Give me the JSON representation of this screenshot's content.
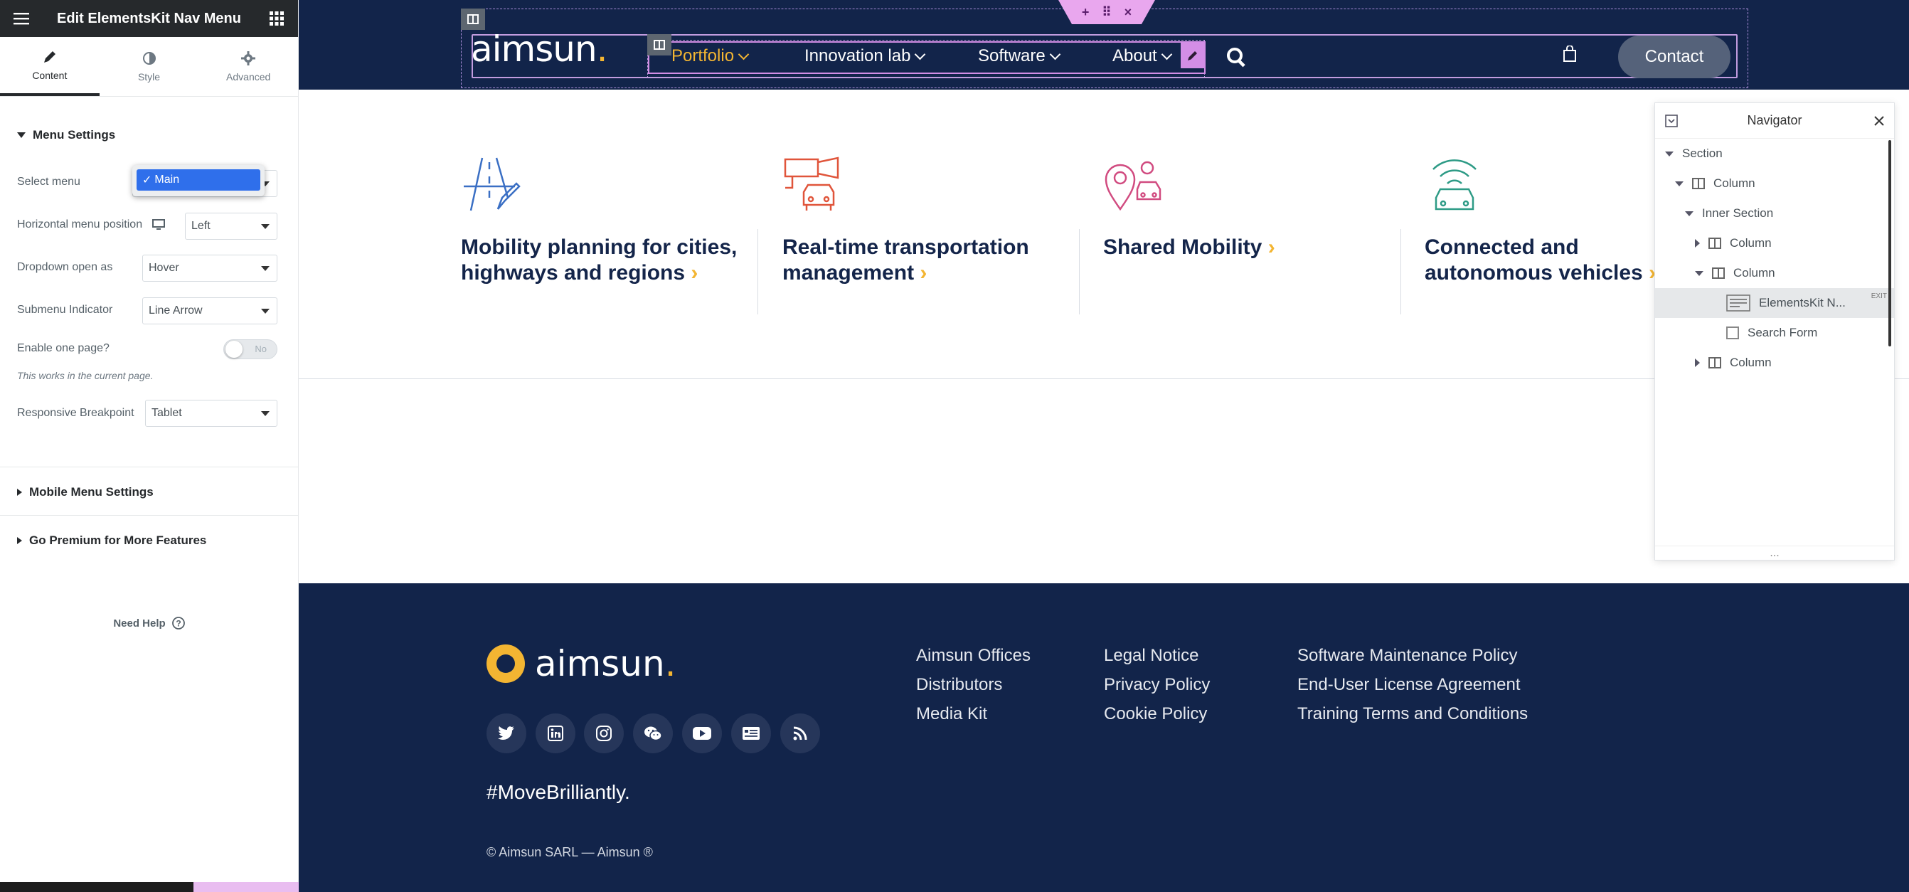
{
  "panel": {
    "title": "Edit ElementsKit Nav Menu",
    "tabs": [
      {
        "label": "Content"
      },
      {
        "label": "Style"
      },
      {
        "label": "Advanced"
      }
    ],
    "menu_settings": {
      "heading": "Menu Settings",
      "select_menu_label": "Select menu",
      "select_menu_value": "Main",
      "horizontal_position_label": "Horizontal menu position",
      "horizontal_position_value": "Left",
      "dropdown_open_label": "Dropdown open as",
      "dropdown_open_value": "Hover",
      "submenu_indicator_label": "Submenu Indicator",
      "submenu_indicator_value": "Line Arrow",
      "one_page_label": "Enable one page?",
      "one_page_toggle": "No",
      "one_page_note": "This works in the current page.",
      "breakpoint_label": "Responsive Breakpoint",
      "breakpoint_value": "Tablet"
    },
    "mobile_menu_heading": "Mobile Menu Settings",
    "premium_heading": "Go Premium for More Features",
    "need_help": "Need Help"
  },
  "site": {
    "logo_text": "aimsun",
    "logo_dot": ".",
    "nav": [
      {
        "label": "Portfolio"
      },
      {
        "label": "Innovation lab"
      },
      {
        "label": "Software"
      },
      {
        "label": "About"
      }
    ],
    "contact_label": "Contact",
    "solutions": [
      {
        "title": "Mobility planning for cities, highways and regions"
      },
      {
        "title": "Real-time transportation management"
      },
      {
        "title": "Shared Mobility"
      },
      {
        "title": "Connected and autonomous vehicles"
      }
    ],
    "arrow": "›"
  },
  "footer": {
    "logo_text": "aimsun",
    "logo_dot": ".",
    "hashtag": "#MoveBrilliantly.",
    "copyright": "© Aimsun SARL — Aimsun ®",
    "links_col1": [
      "Aimsun Offices",
      "Distributors",
      "Media Kit"
    ],
    "links_col2": [
      "Legal Notice",
      "Privacy Policy",
      "Cookie Policy"
    ],
    "links_col3": [
      "Software Maintenance Policy",
      "End-User License Agreement",
      "Training Terms and Conditions"
    ]
  },
  "navigator": {
    "title": "Navigator",
    "items": [
      {
        "label": "Section"
      },
      {
        "label": "Column"
      },
      {
        "label": "Inner Section"
      },
      {
        "label": "Column"
      },
      {
        "label": "Column"
      },
      {
        "label": "ElementsKit N..."
      },
      {
        "label": "Search Form"
      },
      {
        "label": "Column"
      }
    ],
    "edit_badge": "EXIT",
    "more": "..."
  },
  "colors": {
    "brand_navy": "#12244a",
    "brand_yellow": "#f3b532",
    "editor_dark": "#26292c",
    "selection_pink": "#d38ee6"
  }
}
